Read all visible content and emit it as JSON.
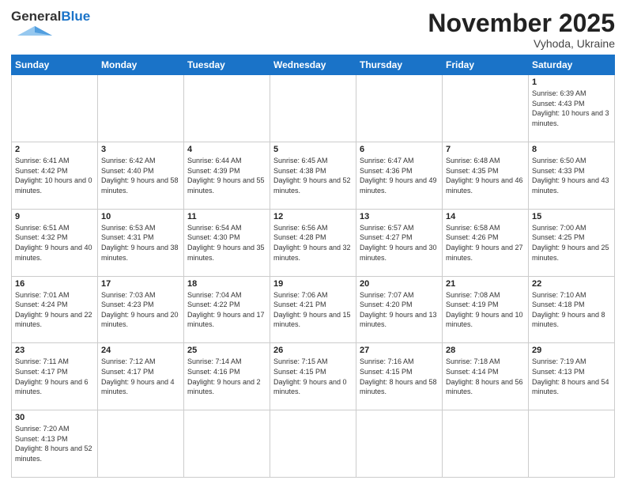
{
  "header": {
    "logo_general": "General",
    "logo_blue": "Blue",
    "month": "November 2025",
    "location": "Vyhoda, Ukraine"
  },
  "weekdays": [
    "Sunday",
    "Monday",
    "Tuesday",
    "Wednesday",
    "Thursday",
    "Friday",
    "Saturday"
  ],
  "weeks": [
    [
      {
        "day": "",
        "info": ""
      },
      {
        "day": "",
        "info": ""
      },
      {
        "day": "",
        "info": ""
      },
      {
        "day": "",
        "info": ""
      },
      {
        "day": "",
        "info": ""
      },
      {
        "day": "",
        "info": ""
      },
      {
        "day": "1",
        "info": "Sunrise: 6:39 AM\nSunset: 4:43 PM\nDaylight: 10 hours\nand 3 minutes."
      }
    ],
    [
      {
        "day": "2",
        "info": "Sunrise: 6:41 AM\nSunset: 4:42 PM\nDaylight: 10 hours\nand 0 minutes."
      },
      {
        "day": "3",
        "info": "Sunrise: 6:42 AM\nSunset: 4:40 PM\nDaylight: 9 hours\nand 58 minutes."
      },
      {
        "day": "4",
        "info": "Sunrise: 6:44 AM\nSunset: 4:39 PM\nDaylight: 9 hours\nand 55 minutes."
      },
      {
        "day": "5",
        "info": "Sunrise: 6:45 AM\nSunset: 4:38 PM\nDaylight: 9 hours\nand 52 minutes."
      },
      {
        "day": "6",
        "info": "Sunrise: 6:47 AM\nSunset: 4:36 PM\nDaylight: 9 hours\nand 49 minutes."
      },
      {
        "day": "7",
        "info": "Sunrise: 6:48 AM\nSunset: 4:35 PM\nDaylight: 9 hours\nand 46 minutes."
      },
      {
        "day": "8",
        "info": "Sunrise: 6:50 AM\nSunset: 4:33 PM\nDaylight: 9 hours\nand 43 minutes."
      }
    ],
    [
      {
        "day": "9",
        "info": "Sunrise: 6:51 AM\nSunset: 4:32 PM\nDaylight: 9 hours\nand 40 minutes."
      },
      {
        "day": "10",
        "info": "Sunrise: 6:53 AM\nSunset: 4:31 PM\nDaylight: 9 hours\nand 38 minutes."
      },
      {
        "day": "11",
        "info": "Sunrise: 6:54 AM\nSunset: 4:30 PM\nDaylight: 9 hours\nand 35 minutes."
      },
      {
        "day": "12",
        "info": "Sunrise: 6:56 AM\nSunset: 4:28 PM\nDaylight: 9 hours\nand 32 minutes."
      },
      {
        "day": "13",
        "info": "Sunrise: 6:57 AM\nSunset: 4:27 PM\nDaylight: 9 hours\nand 30 minutes."
      },
      {
        "day": "14",
        "info": "Sunrise: 6:58 AM\nSunset: 4:26 PM\nDaylight: 9 hours\nand 27 minutes."
      },
      {
        "day": "15",
        "info": "Sunrise: 7:00 AM\nSunset: 4:25 PM\nDaylight: 9 hours\nand 25 minutes."
      }
    ],
    [
      {
        "day": "16",
        "info": "Sunrise: 7:01 AM\nSunset: 4:24 PM\nDaylight: 9 hours\nand 22 minutes."
      },
      {
        "day": "17",
        "info": "Sunrise: 7:03 AM\nSunset: 4:23 PM\nDaylight: 9 hours\nand 20 minutes."
      },
      {
        "day": "18",
        "info": "Sunrise: 7:04 AM\nSunset: 4:22 PM\nDaylight: 9 hours\nand 17 minutes."
      },
      {
        "day": "19",
        "info": "Sunrise: 7:06 AM\nSunset: 4:21 PM\nDaylight: 9 hours\nand 15 minutes."
      },
      {
        "day": "20",
        "info": "Sunrise: 7:07 AM\nSunset: 4:20 PM\nDaylight: 9 hours\nand 13 minutes."
      },
      {
        "day": "21",
        "info": "Sunrise: 7:08 AM\nSunset: 4:19 PM\nDaylight: 9 hours\nand 10 minutes."
      },
      {
        "day": "22",
        "info": "Sunrise: 7:10 AM\nSunset: 4:18 PM\nDaylight: 9 hours\nand 8 minutes."
      }
    ],
    [
      {
        "day": "23",
        "info": "Sunrise: 7:11 AM\nSunset: 4:17 PM\nDaylight: 9 hours\nand 6 minutes."
      },
      {
        "day": "24",
        "info": "Sunrise: 7:12 AM\nSunset: 4:17 PM\nDaylight: 9 hours\nand 4 minutes."
      },
      {
        "day": "25",
        "info": "Sunrise: 7:14 AM\nSunset: 4:16 PM\nDaylight: 9 hours\nand 2 minutes."
      },
      {
        "day": "26",
        "info": "Sunrise: 7:15 AM\nSunset: 4:15 PM\nDaylight: 9 hours\nand 0 minutes."
      },
      {
        "day": "27",
        "info": "Sunrise: 7:16 AM\nSunset: 4:15 PM\nDaylight: 8 hours\nand 58 minutes."
      },
      {
        "day": "28",
        "info": "Sunrise: 7:18 AM\nSunset: 4:14 PM\nDaylight: 8 hours\nand 56 minutes."
      },
      {
        "day": "29",
        "info": "Sunrise: 7:19 AM\nSunset: 4:13 PM\nDaylight: 8 hours\nand 54 minutes."
      }
    ],
    [
      {
        "day": "30",
        "info": "Sunrise: 7:20 AM\nSunset: 4:13 PM\nDaylight: 8 hours\nand 52 minutes."
      },
      {
        "day": "",
        "info": ""
      },
      {
        "day": "",
        "info": ""
      },
      {
        "day": "",
        "info": ""
      },
      {
        "day": "",
        "info": ""
      },
      {
        "day": "",
        "info": ""
      },
      {
        "day": "",
        "info": ""
      }
    ]
  ]
}
